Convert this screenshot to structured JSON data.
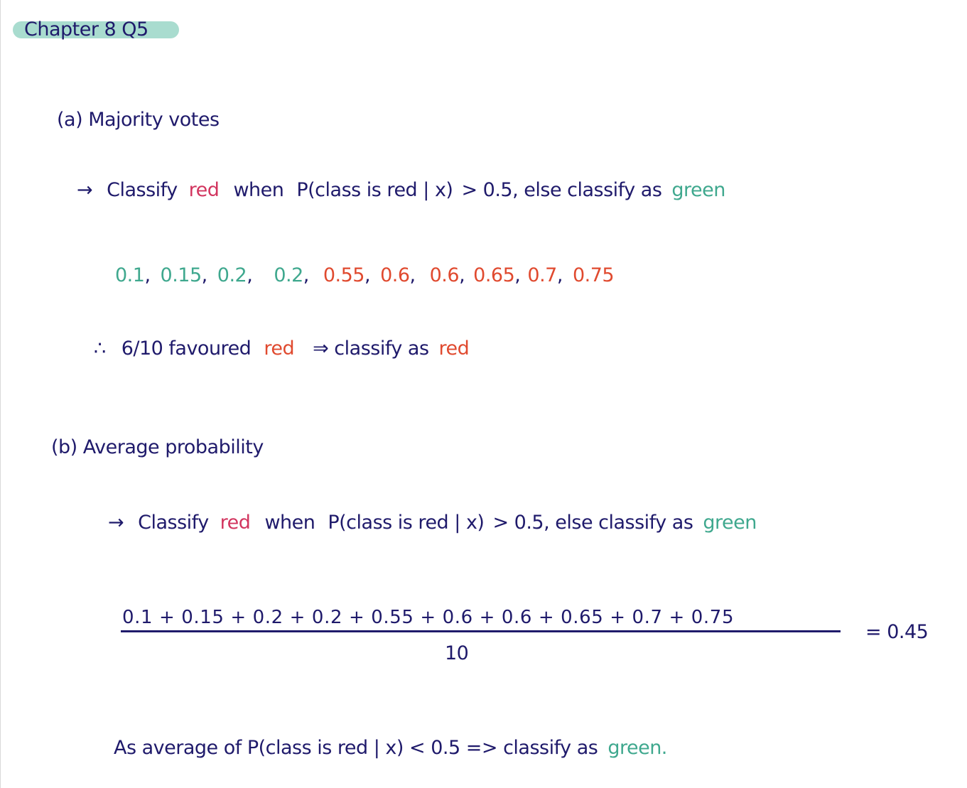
{
  "title": "Chapter 8 Q5",
  "part_a": {
    "heading": "(a) Majority votes",
    "rule": {
      "arrow": "→",
      "w1": "Classify",
      "red_word": "red",
      "w2": "when",
      "cond": "P(class is red | x)",
      "gt": "> 0.5, else classify as",
      "green_word": "green"
    },
    "values": [
      {
        "v": "0.1",
        "sep": ","
      },
      {
        "v": "0.15",
        "sep": ","
      },
      {
        "v": "0.2",
        "sep": ","
      },
      {
        "v": "0.2",
        "sep": ","
      },
      {
        "v": "0.55",
        "sep": ","
      },
      {
        "v": "0.6",
        "sep": ","
      },
      {
        "v": "0.6",
        "sep": ","
      },
      {
        "v": "0.65",
        "sep": ","
      },
      {
        "v": "0.7",
        "sep": ","
      },
      {
        "v": "0.75",
        "sep": ""
      }
    ],
    "conclusion": {
      "therefore": "∴",
      "count": "6/10 favoured",
      "red_word": "red",
      "implies": "⇒ classify as",
      "result": "red"
    }
  },
  "part_b": {
    "heading": "(b) Average probability",
    "rule": {
      "arrow": "→",
      "w1": "Classify",
      "red_word": "red",
      "w2": "when",
      "cond": "P(class is red | x)",
      "gt": "> 0.5, else classify as",
      "green_word": "green"
    },
    "numerator": "0.1 + 0.15 + 0.2 + 0.2 + 0.55 + 0.6 + 0.6 + 0.65 + 0.7 + 0.75",
    "denominator": "10",
    "result": "= 0.45",
    "conclusion": {
      "text": "As average of P(class is red | x) < 0.5 => classify as",
      "green_word": "green."
    }
  },
  "colors": {
    "ink": "#1f1a6b",
    "teal": "#3fa88e",
    "red": "#e04a2f",
    "pink": "#d2355f",
    "highlight": "#a9dccf"
  }
}
